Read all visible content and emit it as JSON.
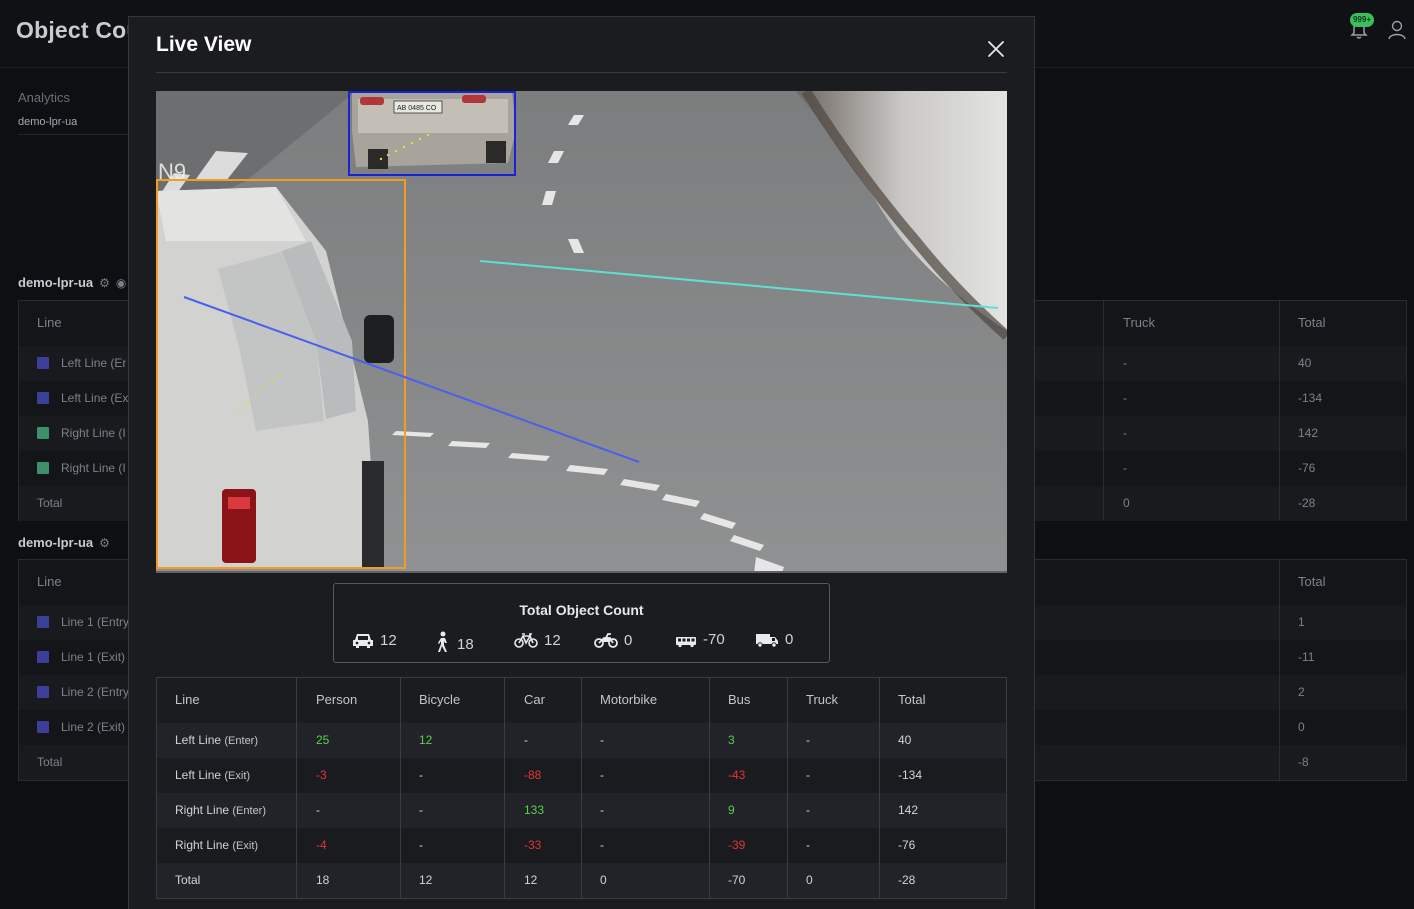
{
  "app": {
    "title": "Object Cou",
    "notifications_badge": "999+"
  },
  "breadcrumb": {
    "section": "Analytics",
    "item": "demo-lpr-ua"
  },
  "bg_sections": [
    {
      "title": "demo-lpr-ua",
      "headers": {
        "line": "Line",
        "truck": "Truck",
        "total": "Total"
      },
      "rows": [
        {
          "label": "Left Line (Er",
          "color": "#3b3f9a",
          "truck": "-",
          "total": "40"
        },
        {
          "label": "Left Line (Ex",
          "color": "#3b3f9a",
          "truck": "-",
          "total": "-134"
        },
        {
          "label": "Right Line (I",
          "color": "#3e8f6a",
          "truck": "-",
          "total": "142"
        },
        {
          "label": "Right Line (I",
          "color": "#3e8f6a",
          "truck": "-",
          "total": "-76"
        },
        {
          "label": "Total",
          "color": "",
          "truck": "0",
          "total": "-28"
        }
      ]
    },
    {
      "title": "demo-lpr-ua",
      "headers": {
        "line": "Line",
        "truck": "",
        "total": "Total"
      },
      "rows": [
        {
          "label": "Line 1 (Entry",
          "color": "#3b3f9a",
          "total": "1"
        },
        {
          "label": "Line 1 (Exit)",
          "color": "#3b3f9a",
          "total": "-11"
        },
        {
          "label": "Line 2 (Entry",
          "color": "#3b3f9a",
          "total": "2"
        },
        {
          "label": "Line 2 (Exit)",
          "color": "#3b3f9a",
          "total": "0"
        },
        {
          "label": "Total",
          "color": "",
          "total": "-8"
        }
      ]
    }
  ],
  "modal": {
    "title": "Live View",
    "close_icon": "close-icon",
    "video": {
      "plate_text": "AB 0485 CO",
      "overlay_text": "N9",
      "box_colors": {
        "car": "#1a22d8",
        "van": "#f59a23"
      },
      "line_colors": {
        "left": "#4b5ef0",
        "right": "#5fe0d0"
      }
    },
    "total_count": {
      "title": "Total Object Count",
      "items": [
        {
          "icon": "car-icon",
          "value": "12"
        },
        {
          "icon": "person-icon",
          "value": "18"
        },
        {
          "icon": "bicycle-icon",
          "value": "12"
        },
        {
          "icon": "motorbike-icon",
          "value": "0"
        },
        {
          "icon": "bus-icon",
          "value": "-70"
        },
        {
          "icon": "truck-icon",
          "value": "0"
        }
      ]
    },
    "table": {
      "headers": [
        "Line",
        "Person",
        "Bicycle",
        "Car",
        "Motorbike",
        "Bus",
        "Truck",
        "Total"
      ],
      "rows": [
        {
          "name": "Left Line",
          "suffix": "(Enter)",
          "cells": [
            "25",
            "12",
            "-",
            "-",
            "3",
            "-",
            "40"
          ]
        },
        {
          "name": "Left Line",
          "suffix": "(Exit)",
          "cells": [
            "-3",
            "-",
            "-88",
            "-",
            "-43",
            "-",
            "-134"
          ]
        },
        {
          "name": "Right Line",
          "suffix": "(Enter)",
          "cells": [
            "-",
            "-",
            "133",
            "-",
            "9",
            "-",
            "142"
          ]
        },
        {
          "name": "Right Line",
          "suffix": "(Exit)",
          "cells": [
            "-4",
            "-",
            "-33",
            "-",
            "-39",
            "-",
            "-76"
          ]
        },
        {
          "name": "Total",
          "suffix": "",
          "cells": [
            "18",
            "12",
            "12",
            "0",
            "-70",
            "0",
            "-28"
          ]
        }
      ]
    }
  },
  "colors": {
    "positive": "#58d04a",
    "negative": "#e0343a",
    "accent_badge": "#3bbf5c"
  }
}
